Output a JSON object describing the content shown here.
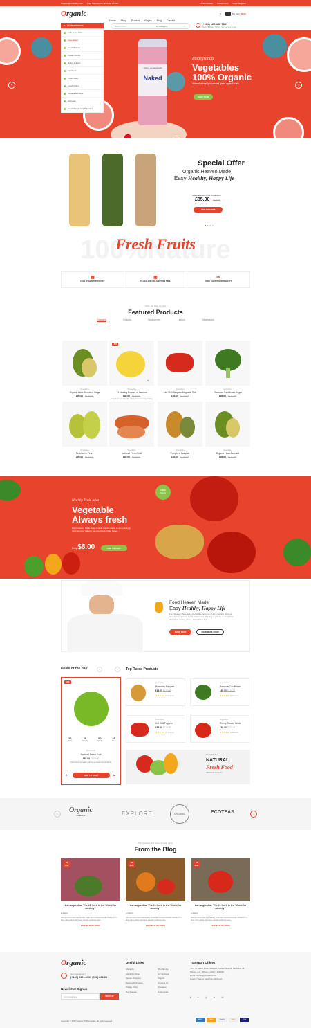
{
  "topbar": {
    "email": "Organic@company.com",
    "shipping": "Free Shipping for all Order of $99",
    "currency": "$ USD (Dollar)",
    "language": "French (CA)",
    "login": "Login Register"
  },
  "header": {
    "logo_a": "O",
    "logo_b": "rganic",
    "nav": [
      "Home",
      "Shop",
      "Product",
      "Pages",
      "Blog",
      "Contact"
    ],
    "cart_count": "0",
    "cart_total": "$0.00",
    "cart_label": "My Cart:",
    "phone": "(+900) 123 456 7891",
    "hours": "Mon-Fri 8.30am - 7.30pm, Sat-Sun 9am to 2pm",
    "search_placeholder": "Search here...",
    "category": "All Category"
  },
  "dept": {
    "label": "All departments",
    "items": [
      "Fruit & Nut Gifts",
      "Vegetables",
      "Fresh Berries",
      "Ocean Foods",
      "Butter & Eggs",
      "Fastfood",
      "Fresh Meat",
      "Fresh Onion",
      "Papaya & Crisps",
      "Oatmeal",
      "Fresh Bananas & Plantains"
    ]
  },
  "hero": {
    "script": "Pomegranate",
    "title1": "Vegetables",
    "title2": "100% Organic",
    "desc": "A blend of freshly squeezed green apple & fruits",
    "btn": "SHOP NOW",
    "bottle_top": "cherry pomegranate",
    "bottle_brand": "Naked"
  },
  "special": {
    "title": "Special Offer",
    "sub1": "Organic Heaven Made",
    "sub2a": "Easy ",
    "sub2b": "Healthy, Happy Life",
    "product": "National Fresh Fruit Production",
    "price": "£85.00",
    "old": "£120.00",
    "btn": "ADD TO CART"
  },
  "fresh": {
    "bg": "100%Nature",
    "title": "Fresh Fruits",
    "features": [
      "FULL STAMINO PRODUCT",
      "PLACE AND DELIVERY ON TIME",
      "FREE SHIPPING IN THE CITY"
    ]
  },
  "featured": {
    "sub": "Wide list item for line",
    "title": "Featured Products",
    "tabs": [
      "Oranges",
      "Grapes",
      "Blueberries",
      "Lemon",
      "Vegetables"
    ],
    "products": [
      {
        "cat": "Vegetables",
        "name": "Organic Hass Avocado, Large",
        "price": "£85.00",
        "old": "£120.00"
      },
      {
        "cat": "Vegetables",
        "name": "13 Healing Powers of Lemons",
        "price": "£85.00",
        "old": "£120.00",
        "badge": "-5%",
        "desc": "All products are carefully selected to ensure food safety.",
        "btn": "ADD TO CART"
      },
      {
        "cat": "Vegetables",
        "name": "Hot Chili Peppers Magnetic Soft",
        "price": "£85.00",
        "old": "£120.00"
      },
      {
        "cat": "Vegetables",
        "name": "Passover Cauliflower Kugel",
        "price": "£85.00",
        "old": "£120.00"
      },
      {
        "cat": "Vegetables",
        "name": "Peckham's Pears",
        "price": "£85.00",
        "old": "£120.00"
      },
      {
        "cat": "Vegetables",
        "name": "National Fresh Fruit",
        "price": "£85.00",
        "old": "£120.00"
      },
      {
        "cat": "Vegetables",
        "name": "Pumpkins Fairytale",
        "price": "£85.00",
        "old": "£120.00"
      },
      {
        "cat": "Vegetables",
        "name": "Organic Hass Avocado",
        "price": "£85.00",
        "old": "£120.00"
      }
    ]
  },
  "juice": {
    "script": "Healthy Fruit Juice",
    "title1": "Vegetable",
    "title2": "Always fresh",
    "desc": "Food Heaven Made Easy sounds like the name of an amazingly delicious food delivery service, but don't be fooled...",
    "only": "Only",
    "price": "$8.00",
    "btn": "ADD TO CART",
    "badge1": "100%",
    "badge2": "Nature"
  },
  "chef": {
    "title1": "Food Heaven Made",
    "title2a": "Easy ",
    "title2b": "Healthy, Happy Life",
    "desc": "Food Heaven Made Easy sounds like the name of an amazingly delicious food delivery service, but don't be fooled. The blog is actually a compilation of recipes, cooking advice, and nutrition tips.",
    "btn1": "SHOP NOW",
    "btn2": "VIEW MENU NOW"
  },
  "deals": {
    "title": "Deals of the day",
    "badge": "-9%",
    "timer": [
      {
        "n": "20",
        "l": "DAYS"
      },
      {
        "n": "30",
        "l": "HOURS"
      },
      {
        "n": "60",
        "l": "MINS"
      },
      {
        "n": "25",
        "l": "SECS"
      }
    ],
    "cat": "Fresh Food",
    "name": "National Fresh Fruit",
    "price": "£85.00",
    "old": "£120.00",
    "desc": "Ultramodern as healthy delicious whole food products.",
    "btn": "ADD TO CART"
  },
  "toprated": {
    "title": "Top Rated Products",
    "items": [
      {
        "cat": "Vegetables",
        "name": "Pumpkins Fairytale",
        "price": "£85.00",
        "old": "£120.00",
        "reviews": "(2) Reviews"
      },
      {
        "cat": "Vegetables",
        "name": "Passover Cauliflower",
        "price": "£85.00",
        "old": "£120.00",
        "reviews": "(2) Reviews"
      },
      {
        "cat": "Vegetables",
        "name": "Hot Chili Peppers",
        "price": "£85.00",
        "old": "£120.00",
        "reviews": "(2) Reviews"
      },
      {
        "cat": "Vegetables",
        "name": "Cherry Tomato Seeds",
        "price": "£85.00",
        "old": "£120.00",
        "reviews": "(2) Reviews"
      }
    ],
    "banner_small": "EASY FRESH",
    "banner1": "NATURAL",
    "banner2": "Fresh Food",
    "banner_sub": "PREMIUM QUALITY"
  },
  "brands": [
    "Organic",
    "EXPLORE",
    "ORGANIC",
    "ECOTEAS"
  ],
  "brands_sub": [
    "GARAGE",
    "Healthy Foods",
    "",
    ""
  ],
  "blog": {
    "sub": "The freshest and most exciting news",
    "title": "From the Blog",
    "posts": [
      {
        "title": "Ashwagandha: The #1 Herb in the World for Anxiety?",
        "author": "Admin",
        "desc": "Did you know that vital-healthy foods are enriched sample research? In fact, many plants that have natural medicinal uses...",
        "more": "CONTINUE READING",
        "date": "28",
        "mon": "JUN"
      },
      {
        "title": "Ashwagandha: The #1 Herb in the World for Anxiety?",
        "author": "Admin",
        "desc": "Did you know that vital-healthy foods are enriched sample research? In fact, many plants that have natural medicinal uses...",
        "more": "CONTINUE READING",
        "date": "28",
        "mon": "JUN"
      },
      {
        "title": "Ashwagandha: The #1 Herb in the World for Anxiety?",
        "author": "Admin",
        "desc": "Did you know that vital-healthy foods are enriched sample research? In fact, many plants that have natural medicinal uses...",
        "more": "CONTINUE READING",
        "date": "28",
        "mon": "JUN"
      }
    ]
  },
  "footer": {
    "question": "Got Questions ?",
    "phones": "(+100) 9001-1909 (900) 899-66",
    "newsletter": "Newsletter Signup",
    "email_ph": "Your email here...",
    "signup": "SIGN UP",
    "useful": "Useful Links",
    "col1": [
      "About Us",
      "About Our Shop",
      "Secure Shopping",
      "Delivery Information",
      "Privacy Policy",
      "Our Sitemap"
    ],
    "col2": [
      "Who We Are",
      "Our Services",
      "Projects",
      "Contacts Us",
      "Innovation",
      "Testimonials"
    ],
    "transport": "Transport Offices",
    "addr": [
      "7563 St. Vicent Place, Glasgow, Greater Newport NE 00491 98",
      "Phone: (+1)...  Phone: (+100) 1 222 999",
      "Email: contact@company.com",
      "Hours: 7 Days a week from 10:00 am"
    ],
    "copyright": "Copyright © 2018 Organic PSD template. All rights reserved",
    "payments": [
      "AMEX",
      "CARD",
      "PayPal",
      "DISC",
      "VISA"
    ]
  }
}
